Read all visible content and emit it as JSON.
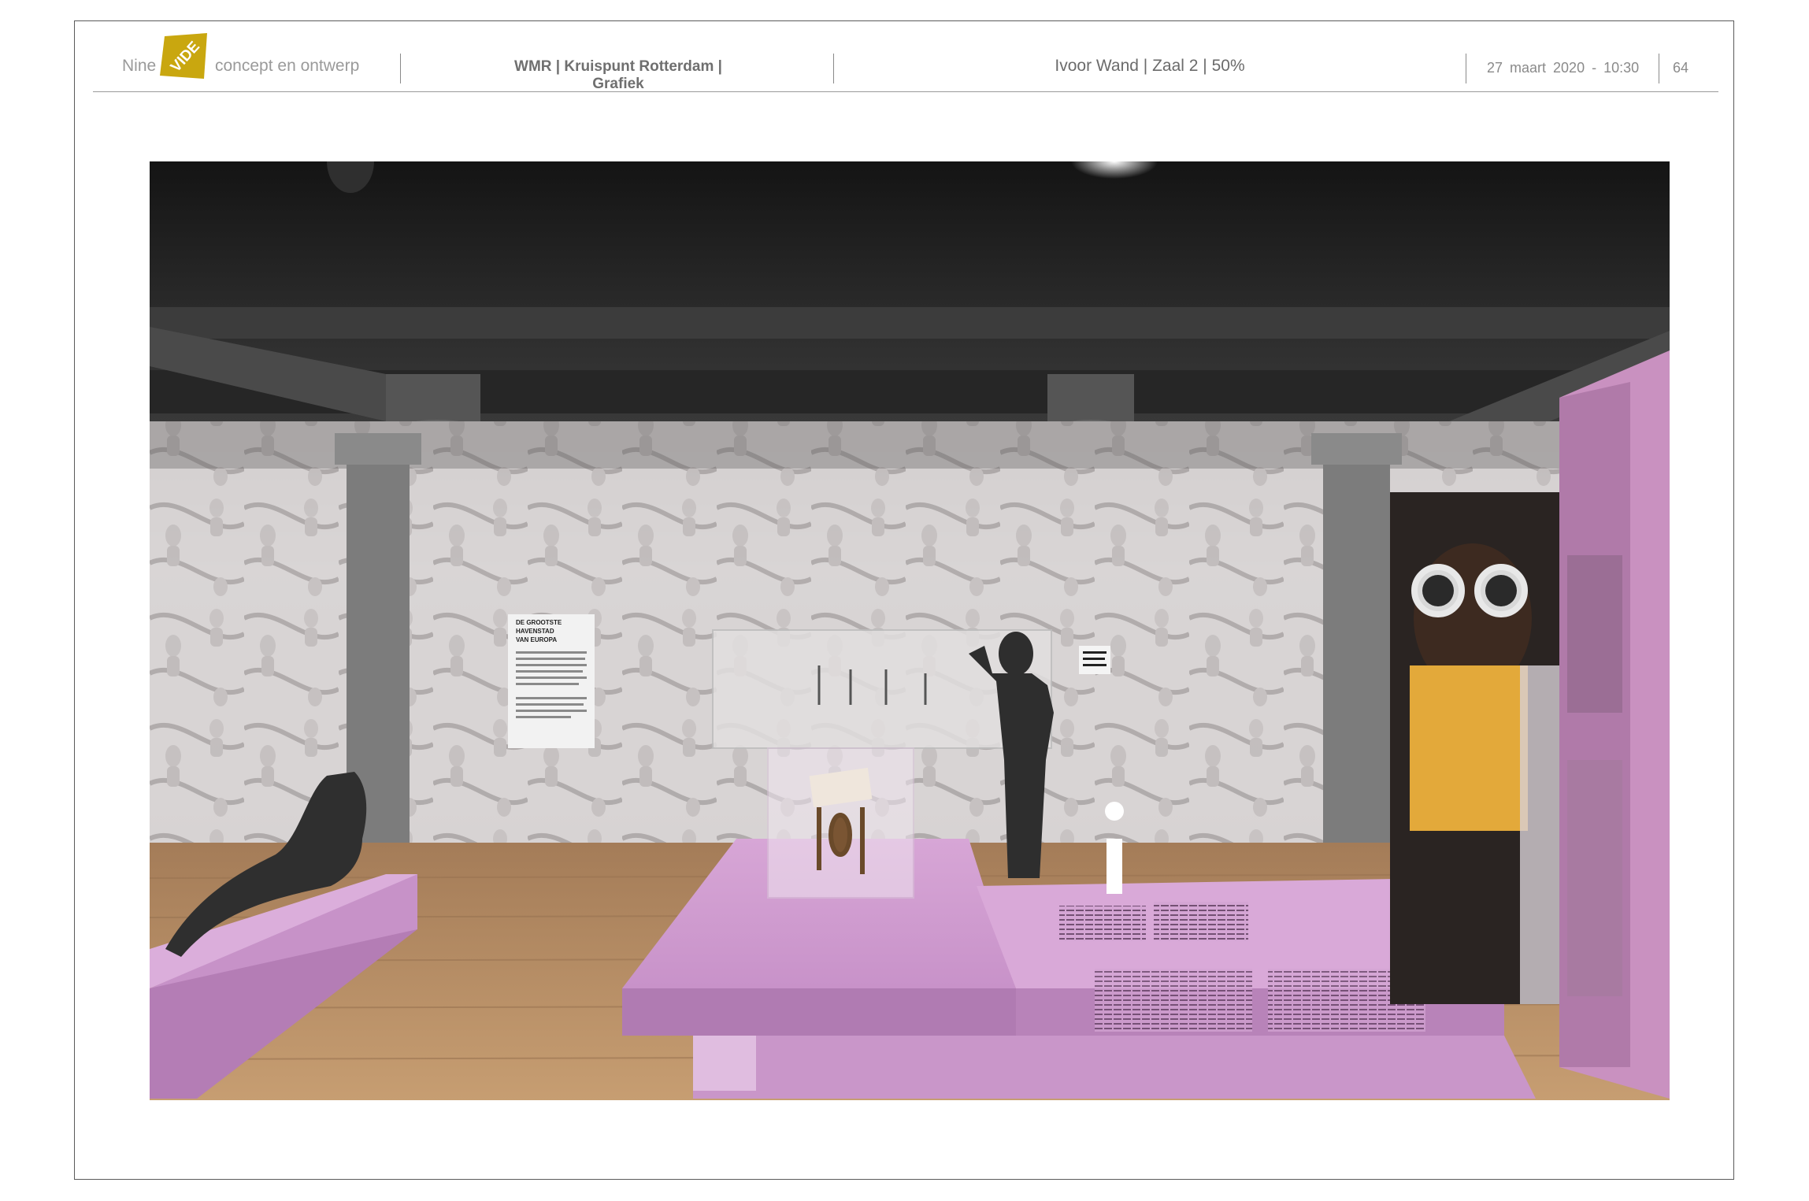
{
  "header": {
    "brand_left": "Nine",
    "brand_logo_text": "VIDE",
    "brand_right": "concept en ontwerp",
    "project_title": "WMR | Kruispunt Rotterdam | Grafiek",
    "view_title": "Ivoor Wand | Zaal 2 | 50%",
    "date": "27 maart 2020 - 10:30",
    "page_number": "64"
  },
  "rendering": {
    "wall_panel_text": [
      "DE GROOTSTE",
      "HAVENSTAD",
      "VAN EUROPA"
    ]
  },
  "colors": {
    "logo_yellow": "#c9a70f",
    "platform_pink": "#cf9ccf",
    "floor_wood": "#b98e62",
    "ceiling_dark": "#2b2b2b",
    "column_grey": "#7c7c7c"
  }
}
